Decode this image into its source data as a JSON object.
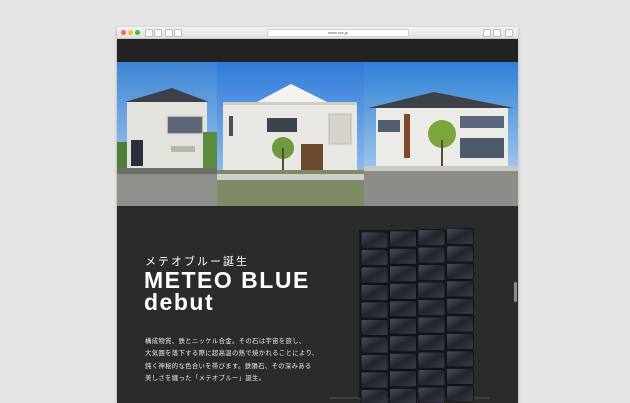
{
  "browser": {
    "address": "www.xxx.jp",
    "traffic_lights": [
      "#ff5f57",
      "#febc2e",
      "#28c840"
    ]
  },
  "hero": {
    "photos": [
      "house-photo-1",
      "house-photo-2",
      "house-photo-3"
    ]
  },
  "content": {
    "heading_jp": "メテオブルー誕生",
    "heading_en_line1": "METEO BLUE",
    "heading_en_line2": "debut",
    "paragraph_lines": [
      "構成物質、鉄とニッケル合金。その石は宇宙を旅し、",
      "大気圏を落下する際に超高温の熱で焼かれることにより、",
      "鈍く神秘的な色合いを帯びます。鉄隕石、その深みある",
      "美しさを纏った「メテオブルー」誕生。"
    ],
    "product_image": "meteo-blue-tile-panel"
  },
  "colors": {
    "page_background": "#2c2c2c",
    "tile": "#2a2d36"
  }
}
